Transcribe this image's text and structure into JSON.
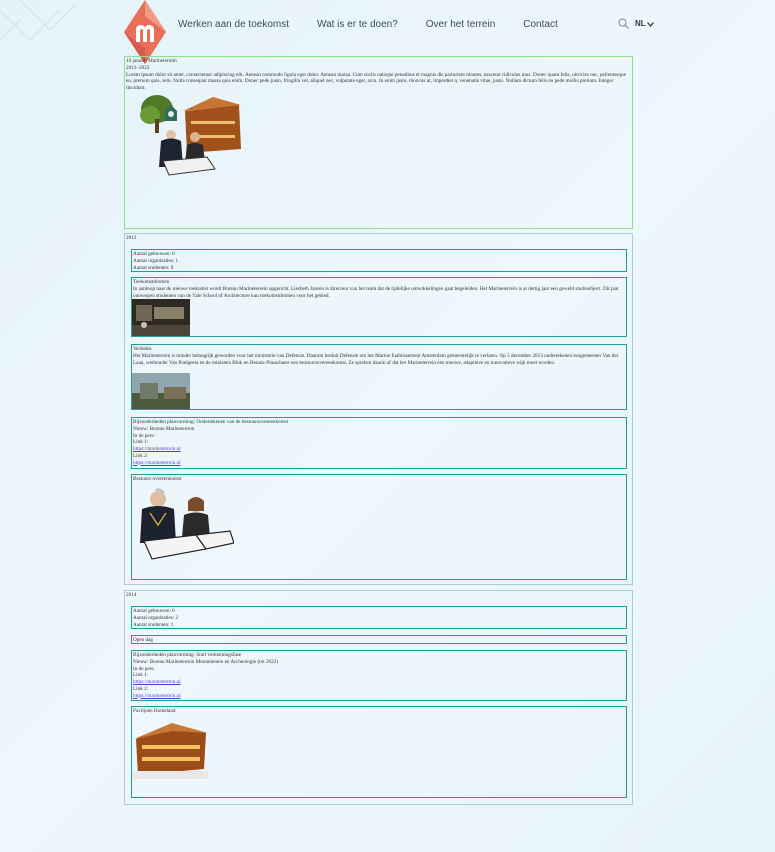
{
  "header": {
    "logo_letter": "m",
    "nav": [
      "Werken aan de toekomst",
      "Wat is er te doen?",
      "Over het terrein",
      "Contact"
    ],
    "lang": "NL",
    "brand_color": "#e8705a"
  },
  "intro": {
    "date": "10 januari Marineterrein",
    "range": "2013–2023",
    "body": "Lorem ipsum dolor sit amet, consectetuer adipiscing elit. Aenean commodo ligula eget dolor. Aenean massa. Cum sociis natoque penatibus et magnis dis parturient montes, nascetur ridiculus mus. Donec quam felis, ultricies nec, pellentesque eu, pretium quis, sem. Nulla consequat massa quis enim. Donec pede justo, fringilla vel, aliquet nec, vulputate eget, arcu. In enim justo, rhoncus ut, imperdiet a, venenatis vitae, justo. Nullam dictum felis eu pede mollis pretium. Integer tincidunt."
  },
  "year2013": {
    "label": "2013",
    "stats": [
      "Aantal gebouwen: 0",
      "Aantal organisaties: 1",
      "Aantal studenten: 0"
    ],
    "toekomst_title": "Toekomstdromen",
    "toekomst_body": "In aanloop naar de nieuwe toekomst wordt Bureau Marineterrein opgericht. Liesbeth Jansen is directeur van het team dat de tijdelijke ontwikkelingen gaat begeleiden. Het Marineterrein is al dertig jaar een geweld studieobject. Dit jaar ontwerpen studenten van de Yale School of Architecture hun toekomstdromen voor het gebied.",
    "verleden_title": "Verleden",
    "verleden_body": "Het Marineterrein is minder belangrijk geworden voor het ministerie van Defensie. Daarom besluit Defensie om het Marine Etablissement Amsterdam gemeentelijk te verlaten. Op 5 december 2013 ondertekenen burgemeester Van der Laan, wethouder Van Poelgeest en de ministers Blok en Hennis-Plasschaert een bestuursovereenkomst. Ze spreken daarin af dat het Marineterrein een nieuwe, adaptieve en innovatieve wijk moet worden.",
    "bijzonder": [
      "Bijzonderheden planvorming: Ondertekenen van de bestuursovereenkomst",
      "Nieuw: Bureau Marineterrein",
      "In de pers:",
      "Link 1:"
    ],
    "link1": "https://marineterrein.nl",
    "link2_label": "Link 2:",
    "link2": "https://marineterrein.nl",
    "bestuurs_title": "Bestuurs overeenkomst"
  },
  "year2014": {
    "label": "2014",
    "stats": [
      "Aantal gebouwen: 0",
      "Aantal organisaties: 2",
      "Aantal studenten: 1"
    ],
    "open_dag": "Open dag",
    "bijzonder": [
      "Bijzonderheden planvorming: Start verkenningsfase",
      "Nieuw: Bureau Marineterrein Monumenten en Archeologie (tot 2022)",
      "In de pers:",
      "Link 1:"
    ],
    "link1": "https://marineterrein.nl",
    "link2_label": "Link 2:",
    "link2": "https://marineterrein.nl",
    "paviljoen_title": "Paviljoen Homeland"
  }
}
